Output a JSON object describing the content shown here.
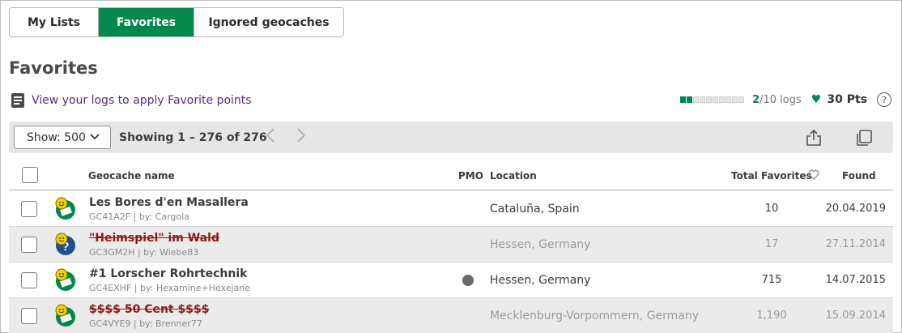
{
  "tabs": [
    {
      "label": "My Lists",
      "active": false
    },
    {
      "label": "Favorites",
      "active": true
    },
    {
      "label": "Ignored geocaches",
      "active": false
    }
  ],
  "page_title": "Favorites",
  "logs_link": "View your logs to apply Favorite points",
  "favorite_meter": {
    "filled_segments": 2,
    "total_segments": 10,
    "count": "2",
    "total_label": "/10 logs",
    "points": "30 Pts",
    "help": "?"
  },
  "toolbar": {
    "show_label": "Show: 500",
    "showing": "Showing 1 – 276 of 276",
    "prev": "‹",
    "next": "›"
  },
  "table": {
    "headers": {
      "name": "Geocache name",
      "pmo": "PMO",
      "location": "Location",
      "total_favorites": "Total Favorites",
      "found": "Found"
    },
    "rows": [
      {
        "name": "Les Bores d'en Masallera",
        "meta": "GC41A2F | by: Cargola",
        "location": "Cataluña, Spain",
        "favorites": "10",
        "found": "20.04.2019",
        "type": "traditional",
        "disabled": false,
        "pmo": false
      },
      {
        "name": "\"Heimspiel\" im Wald",
        "meta": "GC3GM2H | by: Wiebe83",
        "location": "Hessen, Germany",
        "favorites": "17",
        "found": "27.11.2014",
        "type": "mystery",
        "disabled": true,
        "pmo": false
      },
      {
        "name": "#1 Lorscher Rohrtechnik",
        "meta": "GC4EXHF | by: Hexamine+Hexejane",
        "location": "Hessen, Germany",
        "favorites": "715",
        "found": "14.07.2015",
        "type": "traditional",
        "disabled": false,
        "pmo": true
      },
      {
        "name": "$$$$ 50 Cent $$$$",
        "meta": "GC4VYE9 | by: Brenner77",
        "location": "Mecklenburg-Vorpommern, Germany",
        "favorites": "1,190",
        "found": "15.09.2014",
        "type": "traditional",
        "disabled": true,
        "pmo": false
      }
    ]
  },
  "colors": {
    "accent": "#02874d",
    "link": "#5b2a82",
    "disabled_name": "#8b1a1a"
  }
}
